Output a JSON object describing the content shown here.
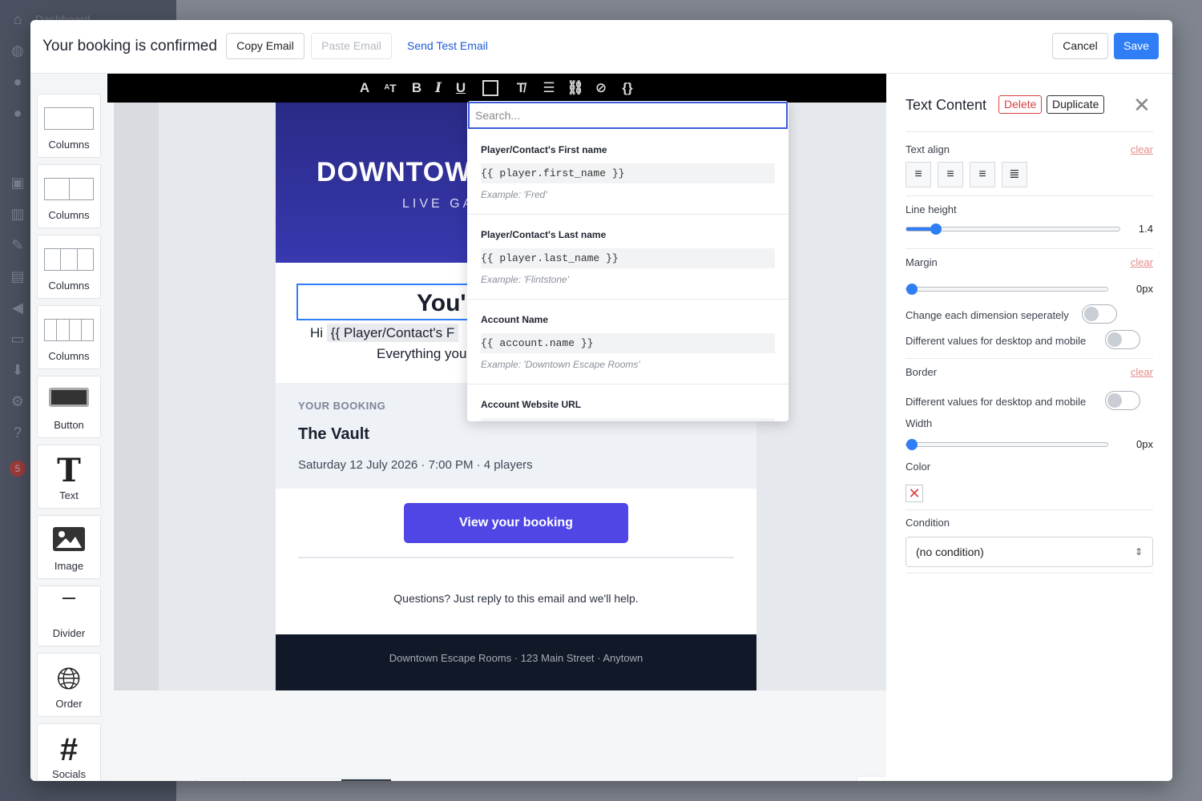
{
  "background": {
    "sidebar_label": "Dashboard",
    "notification_count": "5"
  },
  "header": {
    "title": "Your booking is confirmed",
    "copy_label": "Copy Email",
    "paste_label": "Paste Email",
    "send_test_label": "Send Test Email",
    "cancel_label": "Cancel",
    "save_label": "Save"
  },
  "palette": [
    {
      "label": "Columns",
      "icon": "one-column-icon"
    },
    {
      "label": "Columns",
      "icon": "two-column-icon"
    },
    {
      "label": "Columns",
      "icon": "three-column-icon"
    },
    {
      "label": "Columns",
      "icon": "four-column-icon"
    },
    {
      "label": "Button",
      "icon": "button-icon"
    },
    {
      "label": "Text",
      "icon": "text-icon"
    },
    {
      "label": "Image",
      "icon": "image-icon"
    },
    {
      "label": "Divider",
      "icon": "divider-icon"
    },
    {
      "label": "Order",
      "icon": "globe-icon"
    },
    {
      "label": "Socials",
      "icon": "hash-icon"
    }
  ],
  "email": {
    "hero_title": "DOWNTOWN",
    "hero_sub": "LIVE GA",
    "heading": "You'",
    "greeting_prefix": "Hi",
    "greeting_chip": "{{  Player/Contact's F",
    "greeting_line2": "Everything you",
    "booking_label": "YOUR BOOKING",
    "booking_name": "The Vault",
    "booking_details": "Saturday 12 July 2026  ·  7:00 PM  ·  4 players",
    "cta_label": "View your booking",
    "questions": "Questions? Just reply to this email and we'll help.",
    "footer": "Downtown Escape Rooms  ·  123 Main Street  ·  Anytown"
  },
  "merge_dropdown": {
    "search_placeholder": "Search...",
    "items": [
      {
        "title": "Player/Contact's First name",
        "code": " {{ player.first_name }}",
        "example": "Example: 'Fred'"
      },
      {
        "title": "Player/Contact's Last name",
        "code": " {{ player.last_name }}",
        "example": "Example: 'Flintstone'"
      },
      {
        "title": "Account Name",
        "code": " {{ account.name }}",
        "example": "Example: 'Downtown Escape Rooms'"
      },
      {
        "title": "Account Website URL",
        "code": "",
        "example": ""
      }
    ]
  },
  "props": {
    "title": "Text Content",
    "delete_label": "Delete",
    "duplicate_label": "Duplicate",
    "text_align_label": "Text align",
    "clear_label": "clear",
    "line_height_label": "Line height",
    "line_height_value": "1.4",
    "line_height_fraction": 0.14,
    "margin_label": "Margin",
    "margin_value": "0px",
    "change_each_label": "Change each dimension seperately",
    "diff_values_label": "Different values for desktop and mobile",
    "border_label": "Border",
    "width_label": "Width",
    "width_value": "0px",
    "color_label": "Color",
    "condition_label": "Condition",
    "condition_value": "(no condition)"
  },
  "colors": {
    "accent": "#2f7ef5",
    "cta": "#4f46e5",
    "hero": "#2a2a86",
    "footer": "#111827",
    "danger": "#d94040"
  }
}
